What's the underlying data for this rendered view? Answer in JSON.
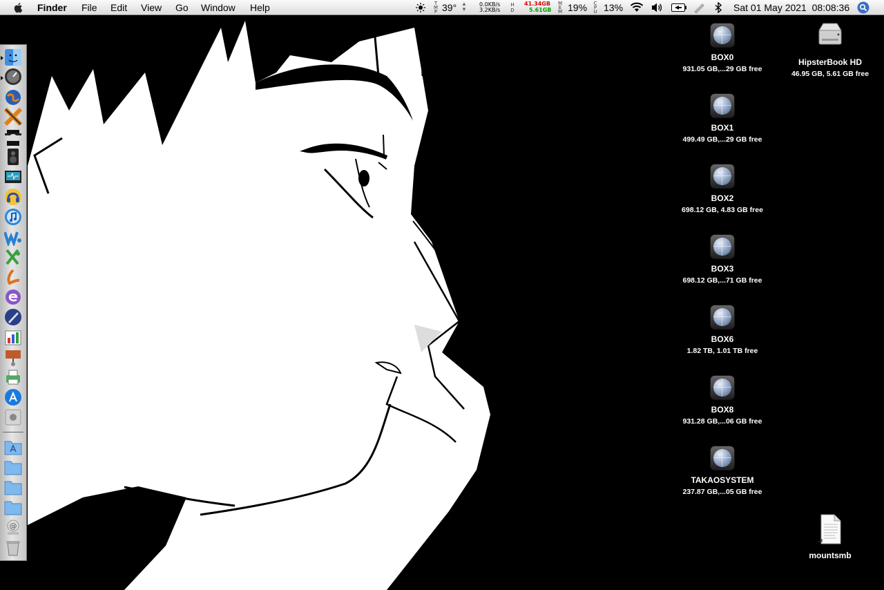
{
  "menubar": {
    "apple_icon": "apple-icon",
    "app_name": "Finder",
    "menus": [
      "File",
      "Edit",
      "View",
      "Go",
      "Window",
      "Help"
    ],
    "status": {
      "temp_label_top": "T",
      "temp_label_mid": "M",
      "temp_label_bot": "P",
      "temperature": "39°",
      "net_up": "0.0KB/s",
      "net_down": "3.2KB/s",
      "disk_label_top": "H",
      "disk_label_bot": "D",
      "disk_used": "41.34GB",
      "disk_free": "5.61GB",
      "mem_label_top": "M",
      "mem_label_mid": "E",
      "mem_label_bot": "M",
      "mem_percent": "19%",
      "cpu_label_top": "C",
      "cpu_label_mid": "P",
      "cpu_label_bot": "U",
      "cpu_percent": "13%",
      "datetime": "Sat 01 May 2021  08:08:36"
    },
    "colors": {
      "disk_used": "#e00000",
      "disk_free": "#00a000"
    }
  },
  "dock": {
    "apps": [
      "finder-icon",
      "dashboard-icon",
      "browser-icon",
      "crossover-icon",
      "spy-agent-icon",
      "speaker-icon",
      "monitor-icon",
      "headphones-icon",
      "itunes-icon",
      "word-icon",
      "excel-icon",
      "acrobat-icon",
      "entourage-icon",
      "pen-app-icon",
      "office-chart-icon",
      "presentation-icon",
      "printer-icon",
      "app-store-icon",
      "system-preferences-icon"
    ],
    "stacks": [
      "applications-folder-icon",
      "documents-folder-icon",
      "downloads-folder-icon",
      "folder-icon",
      "mail-stack-icon",
      "trash-icon"
    ]
  },
  "desktop": {
    "volumes": [
      {
        "name": "BOX0",
        "info": "931.05 GB,...29 GB free",
        "icon": "network-disk-icon"
      },
      {
        "name": "BOX1",
        "info": "499.49 GB,...29 GB free",
        "icon": "network-disk-icon"
      },
      {
        "name": "BOX2",
        "info": "698.12 GB, 4.83 GB free",
        "icon": "network-disk-icon"
      },
      {
        "name": "BOX3",
        "info": "698.12 GB,...71 GB free",
        "icon": "network-disk-icon"
      },
      {
        "name": "BOX6",
        "info": "1.82 TB, 1.01 TB free",
        "icon": "network-disk-icon"
      },
      {
        "name": "BOX8",
        "info": "931.28 GB,...06 GB free",
        "icon": "network-disk-icon"
      },
      {
        "name": "TAKAOSYSTEM",
        "info": "237.87 GB,...05 GB free",
        "icon": "network-disk-icon"
      }
    ],
    "hd": {
      "name": "HipsterBook HD",
      "info": "46.95 GB, 5.61 GB free",
      "icon": "hard-disk-icon"
    },
    "file": {
      "name": "mountsmb",
      "icon": "document-icon"
    }
  }
}
